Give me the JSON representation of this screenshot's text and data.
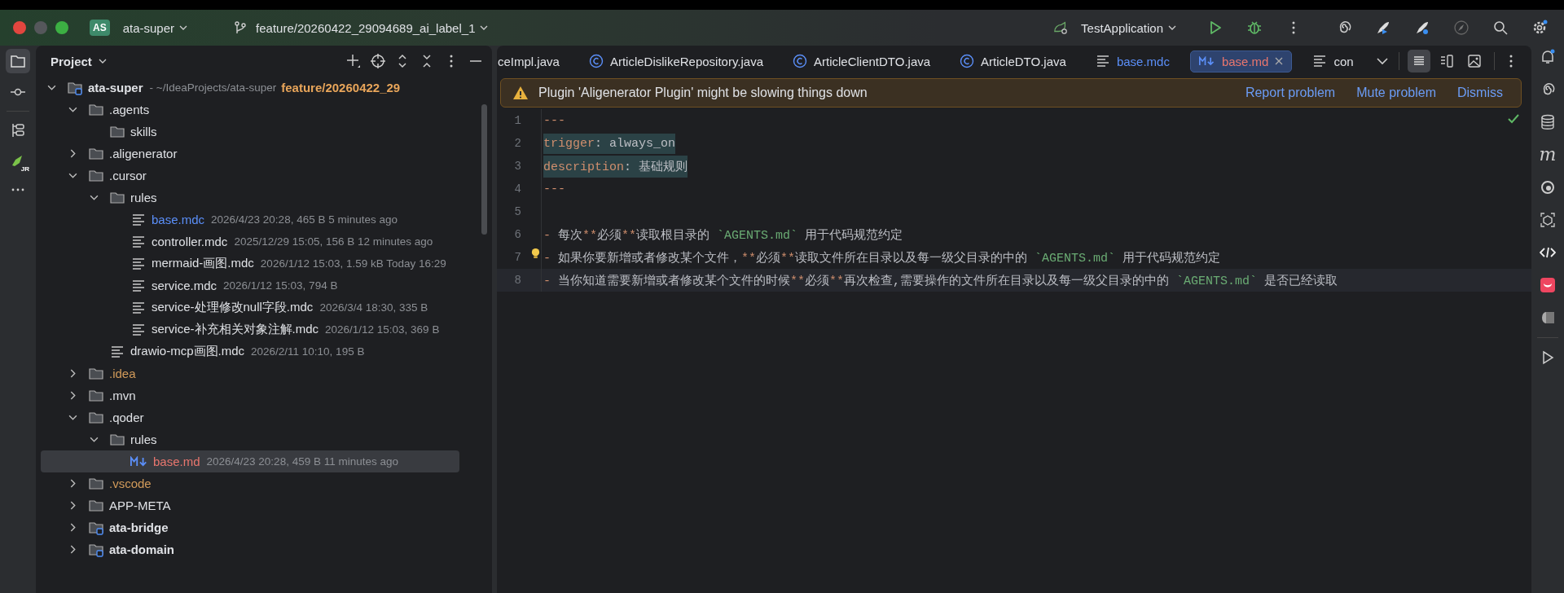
{
  "titlebar": {
    "project_badge": "AS",
    "project": "ata-super",
    "branch": "feature/20260422_29094689_ai_label_1",
    "run_config": "TestApplication"
  },
  "left_strip": {
    "plugin_badge": "JR"
  },
  "project_panel": {
    "title": "Project",
    "tree": [
      {
        "name": "ata-super",
        "kind": "module",
        "bold": true,
        "expanded": true,
        "path": "- ~/IdeaProjects/ata-super",
        "branch": "feature/20260422_29",
        "children": [
          {
            "name": ".agents",
            "kind": "folder",
            "expanded": true,
            "children": [
              {
                "name": "skills",
                "kind": "folder"
              }
            ]
          },
          {
            "name": ".aligenerator",
            "kind": "folder",
            "expanded": false
          },
          {
            "name": ".cursor",
            "kind": "folder",
            "expanded": true,
            "children": [
              {
                "name": "rules",
                "kind": "folder",
                "expanded": true,
                "children": [
                  {
                    "name": "base.mdc",
                    "kind": "text",
                    "color": "#5b8ff9",
                    "detail": "2026/4/23 20:28, 465 B 5 minutes ago"
                  },
                  {
                    "name": "controller.mdc",
                    "kind": "text",
                    "detail": "2025/12/29 15:05, 156 B 12 minutes ago"
                  },
                  {
                    "name": "mermaid-画图.mdc",
                    "kind": "text",
                    "detail": "2026/1/12 15:03, 1.59 kB Today 16:29"
                  },
                  {
                    "name": "service.mdc",
                    "kind": "text",
                    "detail": "2026/1/12 15:03, 794 B"
                  },
                  {
                    "name": "service-处理修改null字段.mdc",
                    "kind": "text",
                    "detail": "2026/3/4 18:30, 335 B"
                  },
                  {
                    "name": "service-补充相关对象注解.mdc",
                    "kind": "text",
                    "detail": "2026/1/12 15:03, 369 B"
                  }
                ]
              },
              {
                "name": "drawio-mcp画图.mdc",
                "kind": "text",
                "detail": "2026/2/11 10:10, 195 B"
              }
            ]
          },
          {
            "name": ".idea",
            "kind": "folder",
            "expanded": false,
            "color": "#d19a5a"
          },
          {
            "name": ".mvn",
            "kind": "folder",
            "expanded": false
          },
          {
            "name": ".qoder",
            "kind": "folder",
            "expanded": true,
            "children": [
              {
                "name": "rules",
                "kind": "folder",
                "expanded": true,
                "children": [
                  {
                    "name": "base.md",
                    "kind": "markdown",
                    "color": "#e8766e",
                    "selected": true,
                    "detail": "2026/4/23 20:28, 459 B 11 minutes ago"
                  }
                ]
              }
            ]
          },
          {
            "name": ".vscode",
            "kind": "folder",
            "expanded": false,
            "color": "#d19a5a"
          },
          {
            "name": "APP-META",
            "kind": "folder",
            "expanded": false
          },
          {
            "name": "ata-bridge",
            "kind": "module",
            "bold": true,
            "expanded": false
          },
          {
            "name": "ata-domain",
            "kind": "module",
            "bold": true,
            "expanded": false
          }
        ]
      }
    ]
  },
  "editor": {
    "tabs": [
      {
        "label": "ceImpl.java",
        "kind": "plain",
        "selected": false
      },
      {
        "label": "ArticleDislikeRepository.java",
        "kind": "class",
        "selected": false
      },
      {
        "label": "ArticleClientDTO.java",
        "kind": "class",
        "selected": false
      },
      {
        "label": "ArticleDTO.java",
        "kind": "class",
        "selected": false
      },
      {
        "label": "base.mdc",
        "kind": "text",
        "color": "#5b8ff9",
        "selected": false
      },
      {
        "label": "base.md",
        "kind": "markdown",
        "color": "#e8766e",
        "selected": true
      },
      {
        "label": "con",
        "kind": "text",
        "selected": false
      }
    ],
    "notification": {
      "message": "Plugin 'Aligenerator Plugin' might be slowing things down",
      "actions": [
        "Report problem",
        "Mute problem",
        "Dismiss"
      ]
    },
    "lines": [
      {
        "number": "1",
        "tokens": [
          {
            "kind": "marker",
            "text": "---"
          }
        ]
      },
      {
        "number": "2",
        "selected": true,
        "tokens": [
          {
            "kind": "key",
            "text": "trigger"
          },
          {
            "kind": "plain",
            "text": ": always_on"
          }
        ]
      },
      {
        "number": "3",
        "selected": true,
        "tokens": [
          {
            "kind": "key",
            "text": "description"
          },
          {
            "kind": "plain",
            "text": ": 基础规则"
          }
        ]
      },
      {
        "number": "4",
        "tokens": [
          {
            "kind": "marker",
            "text": "---"
          }
        ]
      },
      {
        "number": "5"
      },
      {
        "number": "6",
        "tokens": [
          {
            "kind": "marker",
            "text": "- "
          },
          {
            "kind": "plain",
            "text": "每次"
          },
          {
            "kind": "marker",
            "text": "**"
          },
          {
            "kind": "plain",
            "text": "必须"
          },
          {
            "kind": "marker",
            "text": "**"
          },
          {
            "kind": "plain",
            "text": "读取根目录的 "
          },
          {
            "kind": "code",
            "text": "`AGENTS.md`"
          },
          {
            "kind": "plain",
            "text": " 用于代码规范约定"
          }
        ]
      },
      {
        "number": "7",
        "bulb": true,
        "tokens": [
          {
            "kind": "marker",
            "text": "- "
          },
          {
            "kind": "plain",
            "text": "如果你要新增或者修改某个文件，"
          },
          {
            "kind": "marker",
            "text": "**"
          },
          {
            "kind": "plain",
            "text": "必须"
          },
          {
            "kind": "marker",
            "text": "**"
          },
          {
            "kind": "plain",
            "text": "读取文件所在目录以及每一级父目录的中的 "
          },
          {
            "kind": "code",
            "text": "`AGENTS.md`"
          },
          {
            "kind": "plain",
            "text": " 用于代码规范约定"
          }
        ]
      },
      {
        "number": "8",
        "selected": false,
        "current": true,
        "tokens": [
          {
            "kind": "marker",
            "text": "- "
          },
          {
            "kind": "plain",
            "text": "当你知道需要新增或者修改某个文件的时候"
          },
          {
            "kind": "marker",
            "text": "**"
          },
          {
            "kind": "plain",
            "text": "必须"
          },
          {
            "kind": "marker",
            "text": "**"
          },
          {
            "kind": "plain",
            "text": "再次检查,需要操作的文件所在目录以及每一级父目录的中的 "
          },
          {
            "kind": "code",
            "text": "`AGENTS.md`"
          },
          {
            "kind": "plain",
            "text": " 是否已经读取"
          }
        ]
      }
    ]
  },
  "right_strip": {
    "letter_icon": "m"
  }
}
